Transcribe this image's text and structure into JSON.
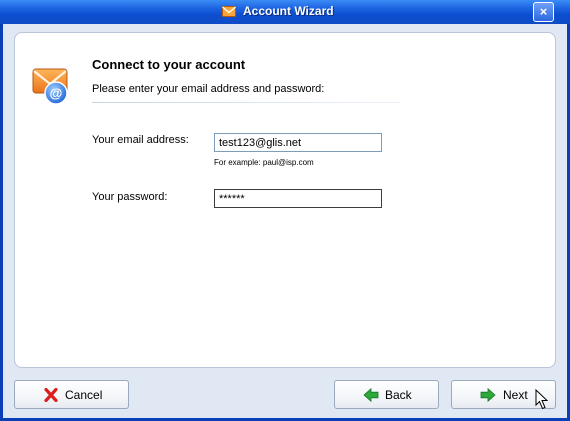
{
  "window": {
    "title": "Account Wizard",
    "close_glyph": "×",
    "icons": {
      "title": "envelope-icon",
      "close": "close-icon"
    }
  },
  "header": {
    "icon": "email-at-icon",
    "title": "Connect to your account",
    "subtitle": "Please enter your email address and password:"
  },
  "form": {
    "email": {
      "label": "Your email address:",
      "value": "test123@glis.net",
      "hint": "For example: paul@isp.com"
    },
    "password": {
      "label": "Your password:",
      "value": "******"
    }
  },
  "footer": {
    "cancel": {
      "label": "Cancel",
      "icon": "red-x-icon"
    },
    "back": {
      "label": "Back",
      "icon": "green-back-arrow-icon"
    },
    "next": {
      "label": "Next",
      "icon": "green-next-arrow-icon"
    }
  },
  "colors": {
    "titlebar": "#1c63e0",
    "client_bg": "#dfe8f3",
    "field_border": "#7f9db9",
    "accent_orange": "#f08c2a",
    "accent_green": "#2fa83a",
    "cancel_red": "#d8201c"
  }
}
